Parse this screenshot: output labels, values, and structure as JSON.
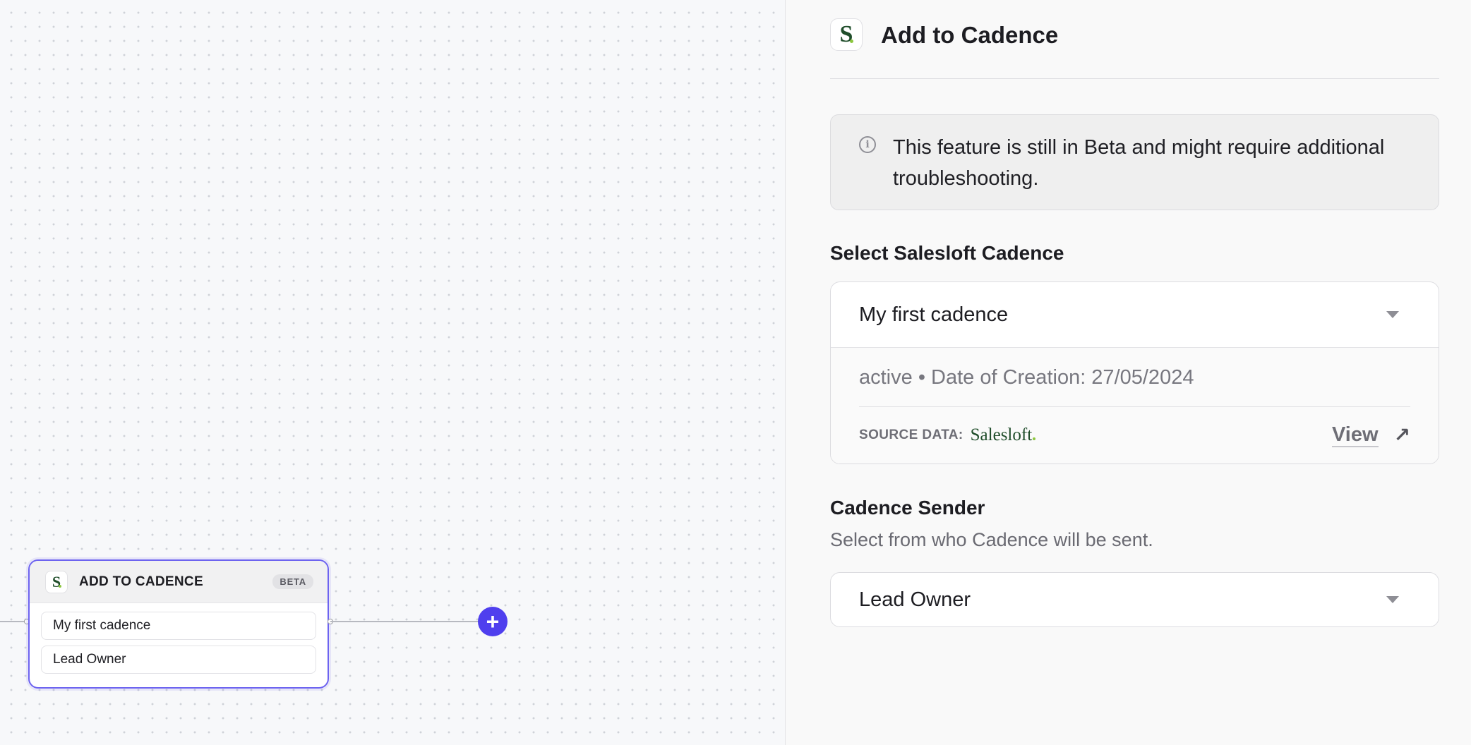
{
  "canvas": {
    "node": {
      "title": "ADD TO CADENCE",
      "badge": "BETA",
      "logo_letter": "S",
      "fields": [
        "My first cadence",
        "Lead Owner"
      ]
    },
    "add_button_symbol": "+"
  },
  "panel": {
    "logo_letter": "S",
    "title": "Add to Cadence",
    "alert": {
      "icon": "info-icon",
      "icon_glyph": "i",
      "text": "This feature is still in Beta and might require additional troubleshooting."
    },
    "cadence_section": {
      "label": "Select Salesloft Cadence",
      "selected": "My first cadence",
      "meta": "active • Date of Creation: 27/05/2024",
      "source_label": "SOURCE DATA:",
      "source_name": "Salesloft",
      "view_label": "View",
      "view_arrow": "↗"
    },
    "sender_section": {
      "label": "Cadence Sender",
      "subtitle": "Select from who Cadence will be sent.",
      "selected": "Lead Owner"
    }
  },
  "colors": {
    "accent": "#4f3fee",
    "node_border": "#6d63f0",
    "salesloft_green": "#1f4d2a",
    "salesloft_dot": "#8cc63f"
  }
}
